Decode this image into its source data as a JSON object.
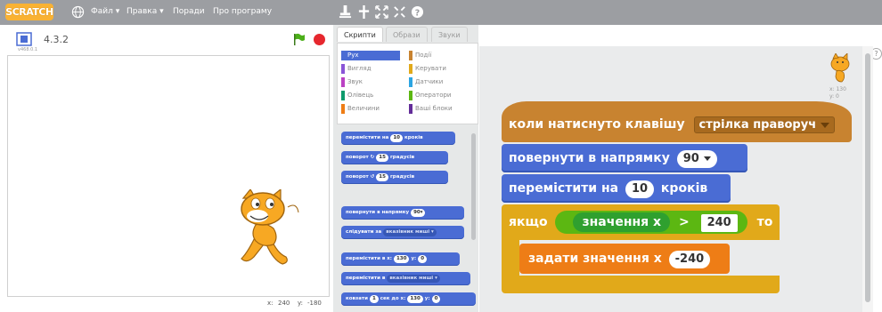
{
  "menubar": {
    "logo": "SCRATCH",
    "items": [
      "Файл ▾",
      "Правка ▾",
      "Поради",
      "Про програму"
    ]
  },
  "stage": {
    "version": "4.3.2",
    "sub_version": "v468.0.1",
    "coords_x_label": "x:",
    "coords_x": "240",
    "coords_y_label": "y:",
    "coords_y": "-180"
  },
  "tabs": [
    "Скрипти",
    "Образи",
    "Звуки"
  ],
  "categories": [
    {
      "label": "Рух",
      "color": "#4a6cd4"
    },
    {
      "label": "Події",
      "color": "#c88330"
    },
    {
      "label": "Вигляд",
      "color": "#8a55d7"
    },
    {
      "label": "Керувати",
      "color": "#e1a91a"
    },
    {
      "label": "Звук",
      "color": "#bb42c3"
    },
    {
      "label": "Датчики",
      "color": "#2ca5e2"
    },
    {
      "label": "Олівець",
      "color": "#0e9a6c"
    },
    {
      "label": "Оператори",
      "color": "#5cb712"
    },
    {
      "label": "Величини",
      "color": "#ee7d16"
    },
    {
      "label": "Ваші блоки",
      "color": "#632d99"
    }
  ],
  "palette_blocks": {
    "move": {
      "pre": "перемістити на",
      "val": "10",
      "post": "кроків"
    },
    "turn_right": {
      "pre": "поворот",
      "val": "15",
      "post": "градусів"
    },
    "turn_left": {
      "pre": "поворот",
      "val": "15",
      "post": "градусів"
    },
    "point_dir": {
      "pre": "повернути в напрямку",
      "val": "90▾"
    },
    "point_towards": {
      "pre": "слідувати за",
      "val": "вказівник миші ▾"
    },
    "goto_xy": {
      "pre": "перемістити в x:",
      "x": "130",
      "y_label": "y:",
      "y": "0"
    },
    "goto": {
      "pre": "перемістити в",
      "val": "вказівник миші ▾"
    },
    "glide": {
      "pre": "ковзати",
      "secs": "1",
      "mid": "сек до x:",
      "x": "130",
      "y_label": "y:",
      "y": "0"
    }
  },
  "script": {
    "hat_label": "коли натиснуто клавішу",
    "hat_key": "стрілка праворуч",
    "point_label": "повернути в напрямку",
    "point_value": "90",
    "move_label": "перемістити на",
    "move_value": "10",
    "move_unit": "кроків",
    "if_label": "якщо",
    "if_reporter": "значення",
    "if_var": "x",
    "if_op": ">",
    "if_value": "240",
    "if_then": "то",
    "set_label": "задати значення",
    "set_var": "x",
    "set_value": "-240"
  },
  "sprite_info": {
    "x": "x: 130",
    "y": "y: 0"
  }
}
